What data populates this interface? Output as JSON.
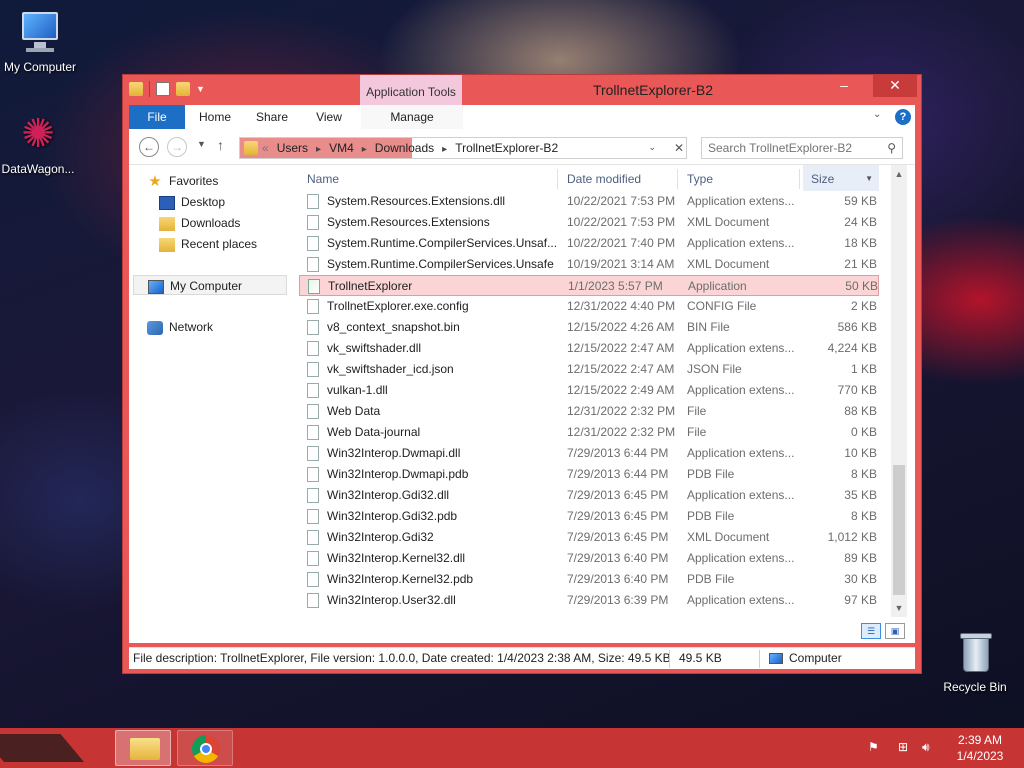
{
  "desktop": {
    "icons": [
      {
        "label": "My Computer",
        "icon": "my-computer-icon"
      },
      {
        "label": "DataWagon...",
        "icon": "datawagon-icon"
      },
      {
        "label": "Recycle Bin",
        "icon": "recycle-bin-icon"
      }
    ]
  },
  "window": {
    "title": "TrollnetExplorer-B2",
    "context_tab": "Application Tools",
    "controls": {
      "minimize": "–",
      "maximize": "□",
      "close": "✕"
    },
    "ribbon_tabs": [
      "File",
      "Home",
      "Share",
      "View",
      "Manage"
    ],
    "address": {
      "crumbs": [
        "«",
        "Users",
        "VM4",
        "Downloads",
        "TrollnetExplorer-B2"
      ]
    },
    "search": {
      "placeholder": "Search TrollnetExplorer-B2"
    }
  },
  "nav_pane": {
    "favorites": "Favorites",
    "favorites_items": [
      "Desktop",
      "Downloads",
      "Recent places"
    ],
    "my_computer": "My Computer",
    "network": "Network"
  },
  "columns": {
    "name": "Name",
    "date": "Date modified",
    "type": "Type",
    "size": "Size"
  },
  "files": [
    {
      "name": "System.Resources.Extensions.dll",
      "date": "10/22/2021 7:53 PM",
      "type": "Application extens...",
      "size": "59 KB",
      "icon": "dll"
    },
    {
      "name": "System.Resources.Extensions",
      "date": "10/22/2021 7:53 PM",
      "type": "XML Document",
      "size": "24 KB",
      "icon": "xml"
    },
    {
      "name": "System.Runtime.CompilerServices.Unsaf...",
      "date": "10/22/2021 7:40 PM",
      "type": "Application extens...",
      "size": "18 KB",
      "icon": "dll"
    },
    {
      "name": "System.Runtime.CompilerServices.Unsafe",
      "date": "10/19/2021 3:14 AM",
      "type": "XML Document",
      "size": "21 KB",
      "icon": "xml"
    },
    {
      "name": "TrollnetExplorer",
      "date": "1/1/2023 5:57 PM",
      "type": "Application",
      "size": "50 KB",
      "icon": "app",
      "selected": true
    },
    {
      "name": "TrollnetExplorer.exe.config",
      "date": "12/31/2022 4:40 PM",
      "type": "CONFIG File",
      "size": "2 KB",
      "icon": "file"
    },
    {
      "name": "v8_context_snapshot.bin",
      "date": "12/15/2022 4:26 AM",
      "type": "BIN File",
      "size": "586 KB",
      "icon": "file"
    },
    {
      "name": "vk_swiftshader.dll",
      "date": "12/15/2022 2:47 AM",
      "type": "Application extens...",
      "size": "4,224 KB",
      "icon": "dll"
    },
    {
      "name": "vk_swiftshader_icd.json",
      "date": "12/15/2022 2:47 AM",
      "type": "JSON File",
      "size": "1 KB",
      "icon": "file"
    },
    {
      "name": "vulkan-1.dll",
      "date": "12/15/2022 2:49 AM",
      "type": "Application extens...",
      "size": "770 KB",
      "icon": "dll"
    },
    {
      "name": "Web Data",
      "date": "12/31/2022 2:32 PM",
      "type": "File",
      "size": "88 KB",
      "icon": "file"
    },
    {
      "name": "Web Data-journal",
      "date": "12/31/2022 2:32 PM",
      "type": "File",
      "size": "0 KB",
      "icon": "file"
    },
    {
      "name": "Win32Interop.Dwmapi.dll",
      "date": "7/29/2013 6:44 PM",
      "type": "Application extens...",
      "size": "10 KB",
      "icon": "dll"
    },
    {
      "name": "Win32Interop.Dwmapi.pdb",
      "date": "7/29/2013 6:44 PM",
      "type": "PDB File",
      "size": "8 KB",
      "icon": "file"
    },
    {
      "name": "Win32Interop.Gdi32.dll",
      "date": "7/29/2013 6:45 PM",
      "type": "Application extens...",
      "size": "35 KB",
      "icon": "dll"
    },
    {
      "name": "Win32Interop.Gdi32.pdb",
      "date": "7/29/2013 6:45 PM",
      "type": "PDB File",
      "size": "8 KB",
      "icon": "file"
    },
    {
      "name": "Win32Interop.Gdi32",
      "date": "7/29/2013 6:45 PM",
      "type": "XML Document",
      "size": "1,012 KB",
      "icon": "xml"
    },
    {
      "name": "Win32Interop.Kernel32.dll",
      "date": "7/29/2013 6:40 PM",
      "type": "Application extens...",
      "size": "89 KB",
      "icon": "dll"
    },
    {
      "name": "Win32Interop.Kernel32.pdb",
      "date": "7/29/2013 6:40 PM",
      "type": "PDB File",
      "size": "30 KB",
      "icon": "file"
    },
    {
      "name": "Win32Interop.User32.dll",
      "date": "7/29/2013 6:39 PM",
      "type": "Application extens...",
      "size": "97 KB",
      "icon": "dll"
    }
  ],
  "status": {
    "description": "File description: TrollnetExplorer, File version: 1.0.0.0, Date created: 1/4/2023 2:38 AM, Size: 49.5 KB",
    "size": "49.5 KB",
    "location": "Computer"
  },
  "taskbar": {
    "time": "2:39 AM",
    "date": "1/4/2023"
  },
  "colors": {
    "window_frame": "#e95757",
    "accent": "#1d6fc6",
    "taskbar": "#c73434",
    "selected_row": "#fbd5d5"
  }
}
